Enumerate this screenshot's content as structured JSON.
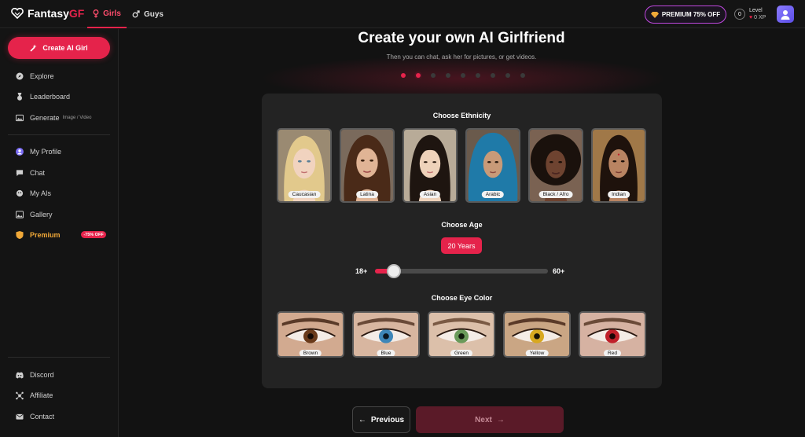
{
  "brand": {
    "name_main": "Fantasy",
    "name_accent": "GF"
  },
  "nav": {
    "girls": "Girls",
    "guys": "Guys"
  },
  "header": {
    "premium_label": "PREMIUM 75% OFF",
    "level_value": "0",
    "level_label": "Level",
    "xp": "0 XP"
  },
  "sidebar": {
    "create_button": "Create AI Girl",
    "items": [
      {
        "label": "Explore"
      },
      {
        "label": "Leaderboard"
      },
      {
        "label": "Generate",
        "sub": "Image / Video"
      },
      {
        "label": "My Profile"
      },
      {
        "label": "Chat"
      },
      {
        "label": "My AIs"
      },
      {
        "label": "Gallery"
      },
      {
        "label": "Premium",
        "badge": "-75% OFF"
      }
    ],
    "footer_items": [
      {
        "label": "Discord"
      },
      {
        "label": "Affiliate"
      },
      {
        "label": "Contact"
      }
    ]
  },
  "main": {
    "title": "Create your own AI Girlfriend",
    "subtitle": "Then you can chat, ask her for pictures, or get videos.",
    "steps_total": 9,
    "current_step": 2
  },
  "ethnicity": {
    "title": "Choose Ethnicity",
    "options": [
      "Caucasian",
      "Latina",
      "Asian",
      "Arabic",
      "Black / Afro",
      "Indian"
    ]
  },
  "age": {
    "title": "Choose Age",
    "value_label": "20 Years",
    "min_label": "18+",
    "max_label": "60+",
    "min": 18,
    "max": 60,
    "value": 20
  },
  "eye_color": {
    "title": "Choose Eye Color",
    "options": [
      "Brown",
      "Blue",
      "Green",
      "Yellow",
      "Red"
    ]
  },
  "buttons": {
    "previous": "Previous",
    "next": "Next"
  },
  "colors": {
    "accent": "#e5234b",
    "premium": "#f0a838",
    "next_disabled": "#5a1a28"
  }
}
